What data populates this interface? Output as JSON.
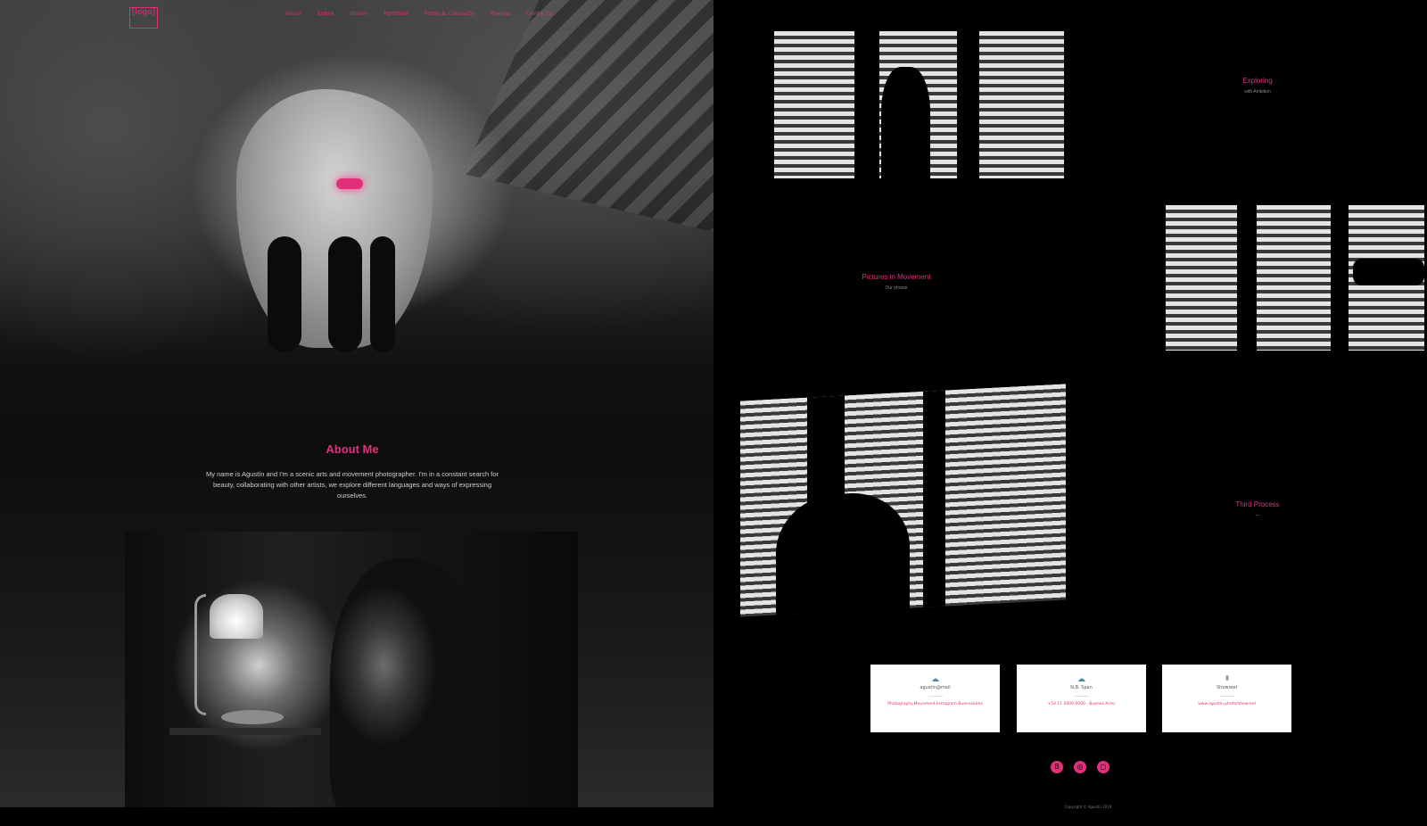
{
  "header": {
    "logo_text": "[logo]",
    "nav": [
      "Inicio",
      "Sobre",
      "Visión",
      "Portfolio",
      "Fotos & Contacto",
      "Prensa",
      "Contacto"
    ]
  },
  "about": {
    "title": "About Me",
    "text": "My name is Agustín and I'm a scenic arts and movement photographer. I'm in a constant search for beauty, collaborating with other artists, we explore different languages and ways of expressing ourselves."
  },
  "projects": [
    {
      "title": "Exploring",
      "subtitle": "with Ambition"
    },
    {
      "title": "Pictures in Movement",
      "subtitle": "Our phrase"
    },
    {
      "title": "Third Process",
      "subtitle": "—"
    }
  ],
  "contact_cards": [
    {
      "icon": "location-icon",
      "title": "agustin@mail",
      "text": "Photography.Movement.Instagram.Buenosaires"
    },
    {
      "icon": "phone-icon",
      "title": "N.B. Span",
      "text": "+54 11 0000 0000 · Buenos Aires"
    },
    {
      "icon": "mic-icon",
      "title": "Showreel",
      "text": "www.agustin.photo/showreel"
    }
  ],
  "social": [
    "behance-icon",
    "dribbble-icon",
    "instagram-icon"
  ],
  "footer": {
    "copyright": "Copyright © Agustín 2019"
  },
  "colors": {
    "accent": "#e0307a",
    "background": "#000000"
  }
}
